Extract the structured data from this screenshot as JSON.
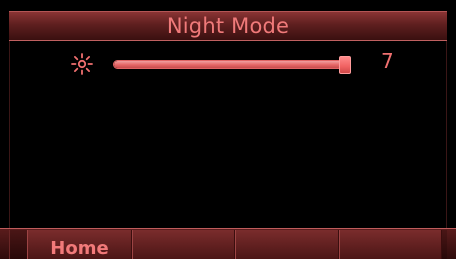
{
  "header": {
    "title": "Night Mode"
  },
  "brightness": {
    "icon": "sun-icon",
    "value_label": "7",
    "level_fraction": 1.0
  },
  "softkeys": [
    {
      "label": "Home"
    },
    {
      "label": ""
    },
    {
      "label": ""
    },
    {
      "label": ""
    }
  ],
  "colors": {
    "accent": "#f07a7a",
    "background": "#000000",
    "bar_dark": "#3a1010",
    "bar_light": "#8a3434"
  }
}
